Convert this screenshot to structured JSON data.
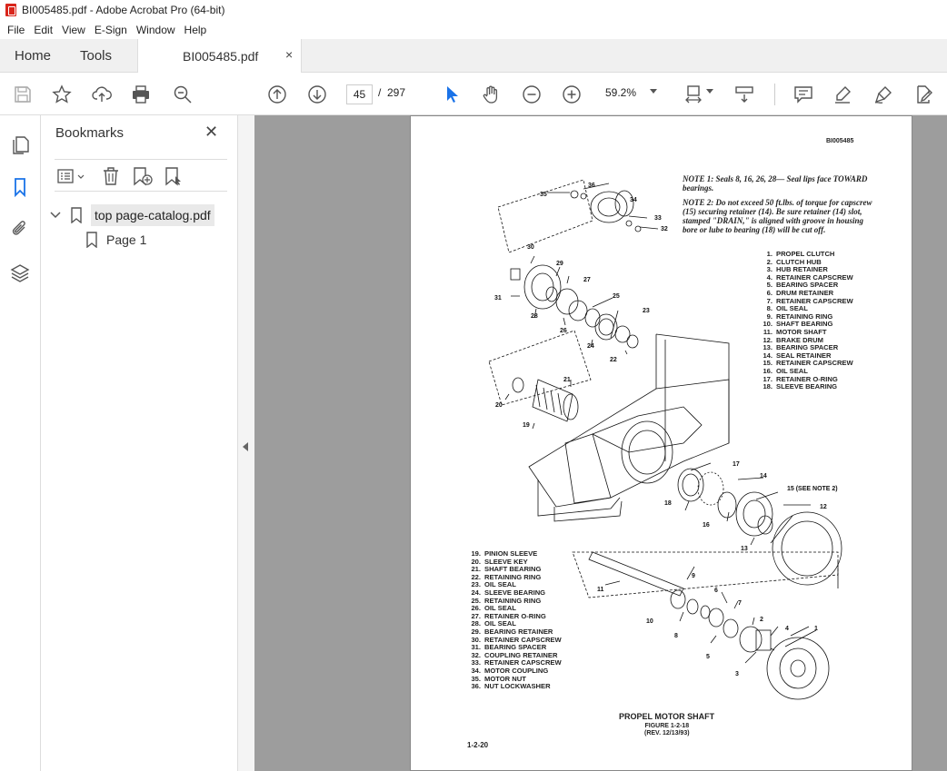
{
  "window": {
    "title": "BI005485.pdf - Adobe Acrobat Pro (64-bit)"
  },
  "menu": [
    "File",
    "Edit",
    "View",
    "E-Sign",
    "Window",
    "Help"
  ],
  "tabs": {
    "home": "Home",
    "tools": "Tools",
    "document": "BI005485.pdf",
    "close": "×"
  },
  "toolbar": {
    "page_current": "45",
    "page_sep": "/",
    "page_total": "297",
    "zoom": "59.2%"
  },
  "bookmarks": {
    "title": "Bookmarks",
    "close": "✕",
    "items": [
      {
        "label": "top page-catalog.pdf"
      },
      {
        "label": "Page 1"
      }
    ]
  },
  "document": {
    "code": "BI005485",
    "note1": "NOTE 1: Seals 8, 16, 26, 28— Seal lips face TOWARD bearings.",
    "note2": "NOTE 2: Do not exceed 50 ft.lbs. of torque for capscrew (15) securing retainer (14). Be sure retainer (14) slot, stamped \"DRAIN,\" is aligned with groove in housing bore or lube to bearing (18) will be cut off.",
    "legend_top": [
      {
        "n": "1.",
        "t": "PROPEL CLUTCH"
      },
      {
        "n": "2.",
        "t": "CLUTCH HUB"
      },
      {
        "n": "3.",
        "t": "HUB RETAINER"
      },
      {
        "n": "4.",
        "t": "RETAINER CAPSCREW"
      },
      {
        "n": "5.",
        "t": "BEARING SPACER"
      },
      {
        "n": "6.",
        "t": "DRUM RETAINER"
      },
      {
        "n": "7.",
        "t": "RETAINER CAPSCREW"
      },
      {
        "n": "8.",
        "t": "OIL SEAL"
      },
      {
        "n": "9.",
        "t": "RETAINING RING"
      },
      {
        "n": "10.",
        "t": "SHAFT BEARING"
      },
      {
        "n": "11.",
        "t": "MOTOR SHAFT"
      },
      {
        "n": "12.",
        "t": "BRAKE DRUM"
      },
      {
        "n": "13.",
        "t": "BEARING SPACER"
      },
      {
        "n": "14.",
        "t": "SEAL RETAINER"
      },
      {
        "n": "15.",
        "t": "RETAINER CAPSCREW"
      },
      {
        "n": "16.",
        "t": "OIL SEAL"
      },
      {
        "n": "17.",
        "t": "RETAINER O-RING"
      },
      {
        "n": "18.",
        "t": "SLEEVE BEARING"
      }
    ],
    "legend_bottom": [
      {
        "n": "19.",
        "t": "PINION SLEEVE"
      },
      {
        "n": "20.",
        "t": "SLEEVE KEY"
      },
      {
        "n": "21.",
        "t": "SHAFT BEARING"
      },
      {
        "n": "22.",
        "t": "RETAINING RING"
      },
      {
        "n": "23.",
        "t": "OIL SEAL"
      },
      {
        "n": "24.",
        "t": "SLEEVE BEARING"
      },
      {
        "n": "25.",
        "t": "RETAINING RING"
      },
      {
        "n": "26.",
        "t": "OIL SEAL"
      },
      {
        "n": "27.",
        "t": "RETAINER O-RING"
      },
      {
        "n": "28.",
        "t": "OIL SEAL"
      },
      {
        "n": "29.",
        "t": "BEARING RETAINER"
      },
      {
        "n": "30.",
        "t": "RETAINER CAPSCREW"
      },
      {
        "n": "31.",
        "t": "BEARING SPACER"
      },
      {
        "n": "32.",
        "t": "COUPLING RETAINER"
      },
      {
        "n": "33.",
        "t": "RETAINER CAPSCREW"
      },
      {
        "n": "34.",
        "t": "MOTOR COUPLING"
      },
      {
        "n": "35.",
        "t": "MOTOR NUT"
      },
      {
        "n": "36.",
        "t": "NUT LOCKWASHER"
      }
    ],
    "figure_title": "PROPEL MOTOR SHAFT",
    "figure_num": "FIGURE 1-2-18",
    "figure_rev": "(REV. 12/13/93)",
    "page_label": "1-2-20",
    "callout_15": "15 (SEE NOTE 2)",
    "callouts": [
      "1",
      "2",
      "3",
      "4",
      "5",
      "6",
      "7",
      "8",
      "9",
      "10",
      "11",
      "12",
      "13",
      "14",
      "16",
      "17",
      "18",
      "19",
      "20",
      "21",
      "22",
      "23",
      "24",
      "25",
      "26",
      "27",
      "28",
      "29",
      "30",
      "31",
      "32",
      "33",
      "34",
      "35",
      "36"
    ]
  },
  "icons": [
    "pdf-icon",
    "save-icon",
    "star-icon",
    "upload-icon",
    "print-icon",
    "search-zoom-icon",
    "arrow-up-icon",
    "arrow-down-icon",
    "select-cursor-icon",
    "hand-icon",
    "zoom-out-icon",
    "zoom-in-icon",
    "fit-page-icon",
    "scroll-icon",
    "comment-icon",
    "highlight-icon",
    "sign-icon",
    "edit-icon",
    "pages-icon",
    "bookmark-icon",
    "attachment-icon",
    "layers-icon"
  ]
}
